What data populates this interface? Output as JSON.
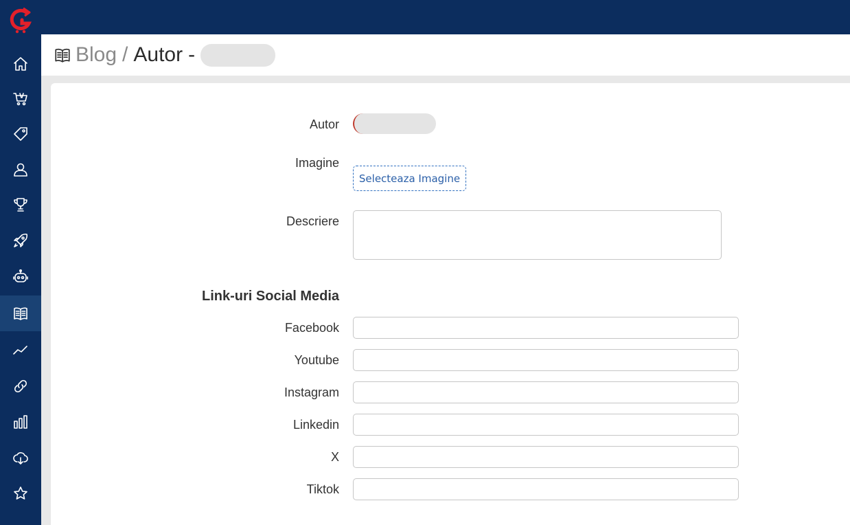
{
  "sidebar": {
    "logo_letter": "G",
    "items": [
      {
        "name": "home-icon",
        "active": false
      },
      {
        "name": "cart-icon",
        "active": false
      },
      {
        "name": "tag-icon",
        "active": false
      },
      {
        "name": "users-icon",
        "active": false
      },
      {
        "name": "trophy-icon",
        "active": false
      },
      {
        "name": "rocket-icon",
        "active": false
      },
      {
        "name": "robot-icon",
        "active": false
      },
      {
        "name": "book-icon",
        "active": true
      },
      {
        "name": "trend-icon",
        "active": false
      },
      {
        "name": "link-icon",
        "active": false
      },
      {
        "name": "bar-chart-icon",
        "active": false
      },
      {
        "name": "cloud-download-icon",
        "active": false
      },
      {
        "name": "star-icon",
        "active": false
      }
    ]
  },
  "header": {
    "breadcrumb_parent": "Blog",
    "separator": "/",
    "title": "Autor",
    "dash": "-"
  },
  "form": {
    "autor_label": "Autor",
    "imagine_label": "Imagine",
    "select_image_button": "Selecteaza Imagine",
    "descriere_label": "Descriere",
    "descriere_value": "",
    "social_section_title": "Link-uri Social Media",
    "social": [
      {
        "label": "Facebook",
        "value": ""
      },
      {
        "label": "Youtube",
        "value": ""
      },
      {
        "label": "Instagram",
        "value": ""
      },
      {
        "label": "Linkedin",
        "value": ""
      },
      {
        "label": "X",
        "value": ""
      },
      {
        "label": "Tiktok",
        "value": ""
      }
    ]
  },
  "colors": {
    "sidebar_bg": "#0c2d5e",
    "sidebar_active": "#1a4274",
    "logo_red": "#e3202a",
    "link_blue": "#2a5fa8"
  }
}
